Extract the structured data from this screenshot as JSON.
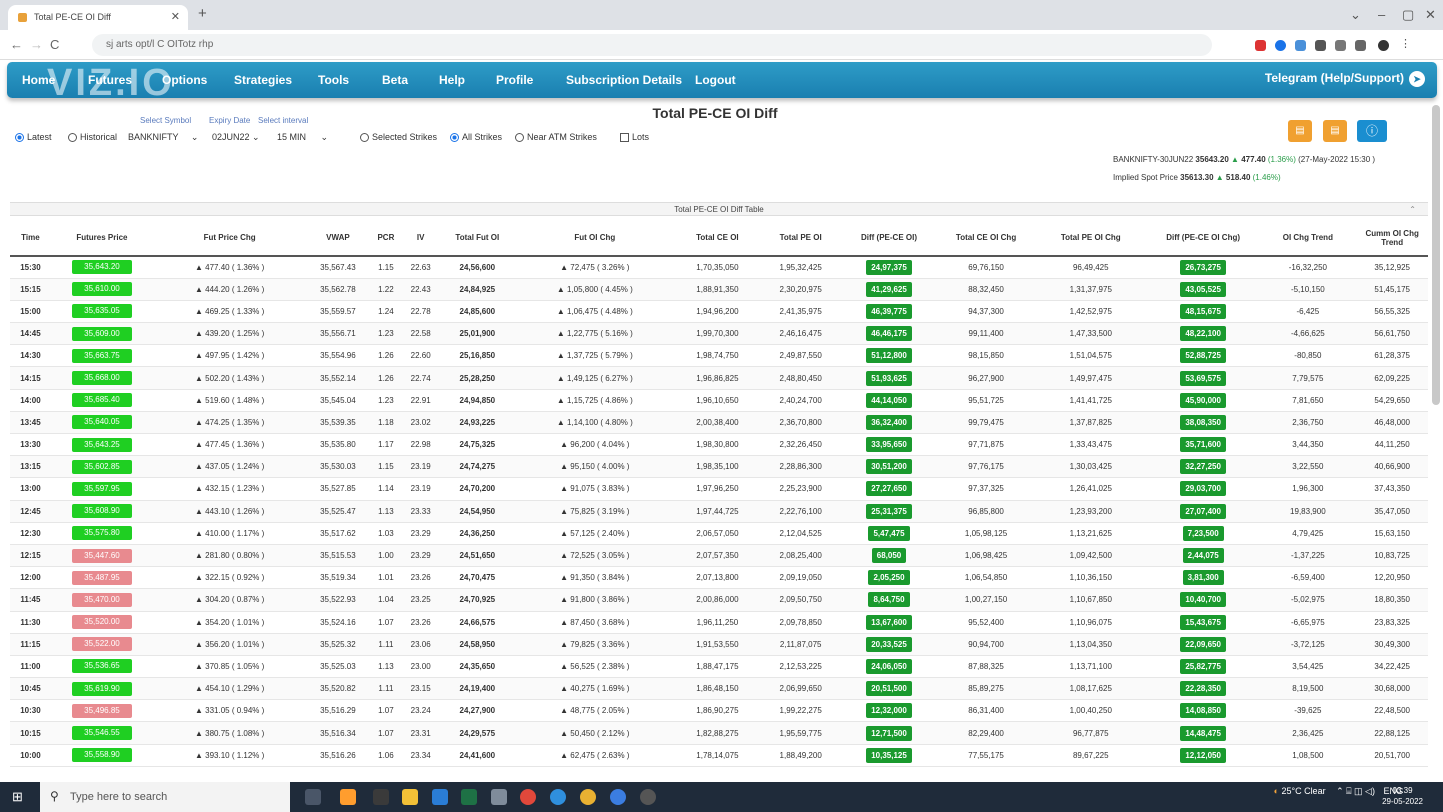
{
  "browser": {
    "tab_title": "Total PE-CE OI Diff",
    "url": "sj arts opt/l C OITotz rhp"
  },
  "menu": {
    "items": [
      "Home",
      "Futures",
      "Options",
      "Strategies",
      "Tools",
      "Beta",
      "Help",
      "Profile",
      "Subscription Details",
      "Logout"
    ],
    "telegram": "Telegram (Help/Support)"
  },
  "page": {
    "title": "Total PE-CE OI Diff",
    "labels": {
      "symbol": "Select Symbol",
      "expiry": "Expiry Date",
      "interval": "Select interval"
    },
    "mode": {
      "latest": "Latest",
      "historical": "Historical"
    },
    "symbol": "BANKNIFTY",
    "expiry": "02JUN22",
    "interval": "15 MIN",
    "strikes": {
      "selected": "Selected Strikes",
      "all": "All Strikes",
      "near": "Near ATM Strikes",
      "lots": "Lots"
    },
    "info_line1": {
      "name": "BANKNIFTY-30JUN22",
      "price": "35643.20",
      "chg": "477.40",
      "pct": "(1.36%)",
      "date": "(27-May-2022 15:30 )"
    },
    "info_line2": {
      "label": "Implied Spot Price",
      "price": "35613.30",
      "chg": "518.40",
      "pct": "(1.46%)"
    }
  },
  "table": {
    "caption": "Total PE-CE OI Diff Table",
    "columns": [
      "Time",
      "Futures Price",
      "Fut Price Chg",
      "VWAP",
      "PCR",
      "IV",
      "Total Fut OI",
      "Fut OI Chg",
      "Total CE OI",
      "Total PE OI",
      "Diff (PE-CE OI)",
      "Total CE OI Chg",
      "Total PE OI Chg",
      "Diff (PE-CE OI Chg)",
      "OI Chg Trend",
      "Cumm OI Chg Trend"
    ],
    "rows": [
      [
        "15:30",
        "35,643.20",
        "g",
        "▲ 477.40  ( 1.36% )",
        "35,567.43",
        "1.15",
        "22.63",
        "24,56,600",
        "▲ 72,475  ( 3.26% )",
        "1,70,35,050",
        "1,95,32,425",
        "24,97,375",
        "69,76,150",
        "96,49,425",
        "26,73,275",
        "-16,32,250",
        "r",
        "35,12,925",
        "pg"
      ],
      [
        "15:15",
        "35,610.00",
        "g",
        "▲ 444.20  ( 1.26% )",
        "35,562.78",
        "1.22",
        "22.43",
        "24,84,925",
        "▲ 1,05,800  ( 4.45% )",
        "1,88,91,350",
        "2,30,20,975",
        "41,29,625",
        "88,32,450",
        "1,31,37,975",
        "43,05,525",
        "-5,10,150",
        "r",
        "51,45,175",
        "pg"
      ],
      [
        "15:00",
        "35,635.05",
        "g",
        "▲ 469.25  ( 1.33% )",
        "35,559.57",
        "1.24",
        "22.78",
        "24,85,600",
        "▲ 1,06,475  ( 4.48% )",
        "1,94,96,200",
        "2,41,35,975",
        "46,39,775",
        "94,37,300",
        "1,42,52,975",
        "48,15,675",
        "-6,425",
        "r",
        "56,55,325",
        "pg"
      ],
      [
        "14:45",
        "35,609.00",
        "g",
        "▲ 439.20  ( 1.25% )",
        "35,556.71",
        "1.23",
        "22.58",
        "25,01,900",
        "▲ 1,22,775  ( 5.16% )",
        "1,99,70,300",
        "2,46,16,475",
        "46,46,175",
        "99,11,400",
        "1,47,33,500",
        "48,22,100",
        "-4,66,625",
        "r",
        "56,61,750",
        "pg"
      ],
      [
        "14:30",
        "35,663.75",
        "g",
        "▲ 497.95  ( 1.42% )",
        "35,554.96",
        "1.26",
        "22.60",
        "25,16,850",
        "▲ 1,37,725  ( 5.79% )",
        "1,98,74,750",
        "2,49,87,550",
        "51,12,800",
        "98,15,850",
        "1,51,04,575",
        "52,88,725",
        "-80,850",
        "r",
        "61,28,375",
        "pg"
      ],
      [
        "14:15",
        "35,668.00",
        "g",
        "▲ 502.20  ( 1.43% )",
        "35,552.14",
        "1.26",
        "22.74",
        "25,28,250",
        "▲ 1,49,125  ( 6.27% )",
        "1,96,86,825",
        "2,48,80,450",
        "51,93,625",
        "96,27,900",
        "1,49,97,475",
        "53,69,575",
        "7,79,575",
        "pg",
        "62,09,225",
        "pg"
      ],
      [
        "14:00",
        "35,685.40",
        "g",
        "▲ 519.60  ( 1.48% )",
        "35,545.04",
        "1.23",
        "22.91",
        "24,94,850",
        "▲ 1,15,725  ( 4.86% )",
        "1,96,10,650",
        "2,40,24,700",
        "44,14,050",
        "95,51,725",
        "1,41,41,725",
        "45,90,000",
        "7,81,650",
        "pg",
        "54,29,650",
        "pg"
      ],
      [
        "13:45",
        "35,640.05",
        "g",
        "▲ 474.25  ( 1.35% )",
        "35,539.35",
        "1.18",
        "23.02",
        "24,93,225",
        "▲ 1,14,100  ( 4.80% )",
        "2,00,38,400",
        "2,36,70,800",
        "36,32,400",
        "99,79,475",
        "1,37,87,825",
        "38,08,350",
        "2,36,750",
        "pg",
        "46,48,000",
        "pg"
      ],
      [
        "13:30",
        "35,643.25",
        "g",
        "▲ 477.45  ( 1.36% )",
        "35,535.80",
        "1.17",
        "22.98",
        "24,75,325",
        "▲ 96,200  ( 4.04% )",
        "1,98,30,800",
        "2,32,26,450",
        "33,95,650",
        "97,71,875",
        "1,33,43,475",
        "35,71,600",
        "3,44,350",
        "pg",
        "44,11,250",
        "pg"
      ],
      [
        "13:15",
        "35,602.85",
        "g",
        "▲ 437.05  ( 1.24% )",
        "35,530.03",
        "1.15",
        "23.19",
        "24,74,275",
        "▲ 95,150  ( 4.00% )",
        "1,98,35,100",
        "2,28,86,300",
        "30,51,200",
        "97,76,175",
        "1,30,03,425",
        "32,27,250",
        "3,22,550",
        "pg",
        "40,66,900",
        "pg"
      ],
      [
        "13:00",
        "35,597.95",
        "g",
        "▲ 432.15  ( 1.23% )",
        "35,527.85",
        "1.14",
        "23.19",
        "24,70,200",
        "▲ 91,075  ( 3.83% )",
        "1,97,96,250",
        "2,25,23,900",
        "27,27,650",
        "97,37,325",
        "1,26,41,025",
        "29,03,700",
        "1,96,300",
        "pg",
        "37,43,350",
        "pg"
      ],
      [
        "12:45",
        "35,608.90",
        "g",
        "▲ 443.10  ( 1.26% )",
        "35,525.47",
        "1.13",
        "23.33",
        "24,54,950",
        "▲ 75,825  ( 3.19% )",
        "1,97,44,725",
        "2,22,76,100",
        "25,31,375",
        "96,85,800",
        "1,23,93,200",
        "27,07,400",
        "19,83,900",
        "pg",
        "35,47,050",
        "pg"
      ],
      [
        "12:30",
        "35,575.80",
        "g",
        "▲ 410.00  ( 1.17% )",
        "35,517.62",
        "1.03",
        "23.29",
        "24,36,250",
        "▲ 57,125  ( 2.40% )",
        "2,06,57,050",
        "2,12,04,525",
        "5,47,475",
        "1,05,98,125",
        "1,13,21,625",
        "7,23,500",
        "4,79,425",
        "pg",
        "15,63,150",
        "pg"
      ],
      [
        "12:15",
        "35,447.60",
        "r",
        "▲ 281.80  ( 0.80% )",
        "35,515.53",
        "1.00",
        "23.29",
        "24,51,650",
        "▲ 72,525  ( 3.05% )",
        "2,07,57,350",
        "2,08,25,400",
        "68,050",
        "1,06,98,425",
        "1,09,42,500",
        "2,44,075",
        "-1,37,225",
        "r",
        "10,83,725",
        "pg"
      ],
      [
        "12:00",
        "35,487.95",
        "r",
        "▲ 322.15  ( 0.92% )",
        "35,519.34",
        "1.01",
        "23.26",
        "24,70,475",
        "▲ 91,350  ( 3.84% )",
        "2,07,13,800",
        "2,09,19,050",
        "2,05,250",
        "1,06,54,850",
        "1,10,36,150",
        "3,81,300",
        "-6,59,400",
        "r",
        "12,20,950",
        "pg"
      ],
      [
        "11:45",
        "35,470.00",
        "r",
        "▲ 304.20  ( 0.87% )",
        "35,522.93",
        "1.04",
        "23.25",
        "24,70,925",
        "▲ 91,800  ( 3.86% )",
        "2,00,86,000",
        "2,09,50,750",
        "8,64,750",
        "1,00,27,150",
        "1,10,67,850",
        "10,40,700",
        "-5,02,975",
        "r",
        "18,80,350",
        "pg"
      ],
      [
        "11:30",
        "35,520.00",
        "r",
        "▲ 354.20  ( 1.01% )",
        "35,524.16",
        "1.07",
        "23.26",
        "24,66,575",
        "▲ 87,450  ( 3.68% )",
        "1,96,11,250",
        "2,09,78,850",
        "13,67,600",
        "95,52,400",
        "1,10,96,075",
        "15,43,675",
        "-6,65,975",
        "r",
        "23,83,325",
        "pg"
      ],
      [
        "11:15",
        "35,522.00",
        "r",
        "▲ 356.20  ( 1.01% )",
        "35,525.32",
        "1.11",
        "23.06",
        "24,58,950",
        "▲ 79,825  ( 3.36% )",
        "1,91,53,550",
        "2,11,87,075",
        "20,33,525",
        "90,94,700",
        "1,13,04,350",
        "22,09,650",
        "-3,72,125",
        "r",
        "30,49,300",
        "pg"
      ],
      [
        "11:00",
        "35,536.65",
        "g",
        "▲ 370.85  ( 1.05% )",
        "35,525.03",
        "1.13",
        "23.00",
        "24,35,650",
        "▲ 56,525  ( 2.38% )",
        "1,88,47,175",
        "2,12,53,225",
        "24,06,050",
        "87,88,325",
        "1,13,71,100",
        "25,82,775",
        "3,54,425",
        "pg",
        "34,22,425",
        "pg"
      ],
      [
        "10:45",
        "35,619.90",
        "g",
        "▲ 454.10  ( 1.29% )",
        "35,520.82",
        "1.11",
        "23.15",
        "24,19,400",
        "▲ 40,275  ( 1.69% )",
        "1,86,48,150",
        "2,06,99,650",
        "20,51,500",
        "85,89,275",
        "1,08,17,625",
        "22,28,350",
        "8,19,500",
        "pg",
        "30,68,000",
        "pg"
      ],
      [
        "10:30",
        "35,496.85",
        "r",
        "▲ 331.05  ( 0.94% )",
        "35,516.29",
        "1.07",
        "23.24",
        "24,27,900",
        "▲ 48,775  ( 2.05% )",
        "1,86,90,275",
        "1,99,22,275",
        "12,32,000",
        "86,31,400",
        "1,00,40,250",
        "14,08,850",
        "-39,625",
        "r",
        "22,48,500",
        "pg"
      ],
      [
        "10:15",
        "35,546.55",
        "g",
        "▲ 380.75  ( 1.08% )",
        "35,516.34",
        "1.07",
        "23.31",
        "24,29,575",
        "▲ 50,450  ( 2.12% )",
        "1,82,88,275",
        "1,95,59,775",
        "12,71,500",
        "82,29,400",
        "96,77,875",
        "14,48,475",
        "2,36,425",
        "pg",
        "22,88,125",
        "pg"
      ],
      [
        "10:00",
        "35,558.90",
        "g",
        "▲ 393.10  ( 1.12% )",
        "35,516.26",
        "1.06",
        "23.34",
        "24,41,600",
        "▲ 62,475  ( 2.63% )",
        "1,78,14,075",
        "1,88,49,200",
        "10,35,125",
        "77,55,175",
        "89,67,225",
        "12,12,050",
        "1,08,500",
        "pg",
        "20,51,700",
        "pg"
      ]
    ]
  },
  "taskbar": {
    "search": "Type here to search",
    "weather": "25°C  Clear",
    "lang": "ENG",
    "time": "03:39",
    "date": "29-05-2022"
  }
}
